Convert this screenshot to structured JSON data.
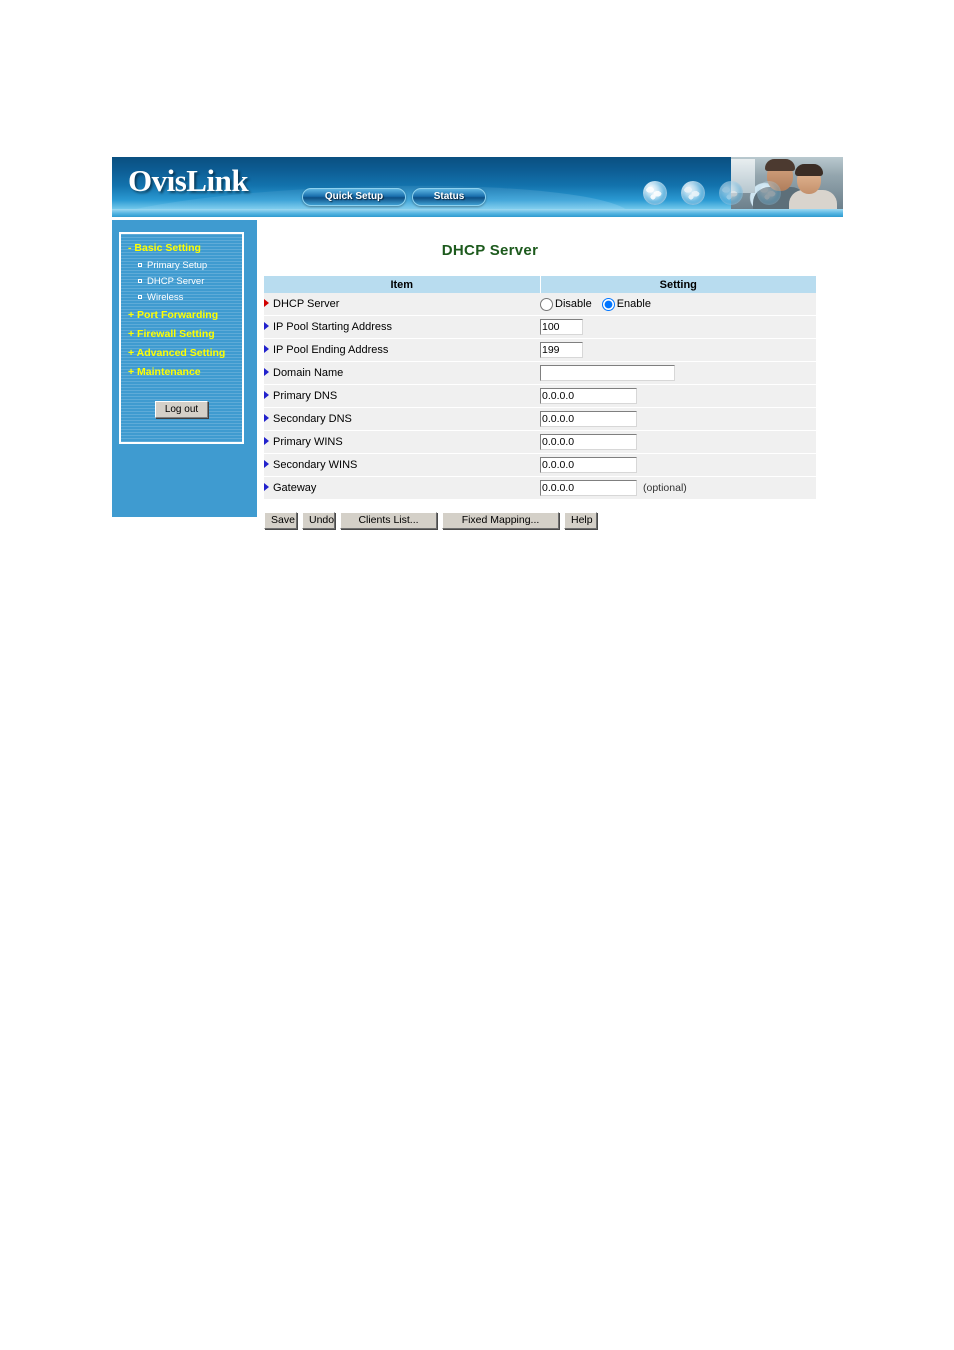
{
  "banner": {
    "logo_text": "OvisLink",
    "nav_pills": [
      {
        "label": "Quick Setup",
        "name": "quick-setup"
      },
      {
        "label": "Status",
        "name": "status"
      }
    ],
    "globe_icons": [
      "globe-icon-1",
      "globe-icon-2",
      "globe-icon-3",
      "globe-icon-4"
    ],
    "photo_alt": "family-at-computer-photo"
  },
  "sidebar": {
    "groups": [
      {
        "prefix": "-",
        "label": "Basic Setting",
        "expanded": true,
        "children": [
          {
            "label": "Primary Setup"
          },
          {
            "label": "DHCP Server"
          },
          {
            "label": "Wireless"
          }
        ]
      },
      {
        "prefix": "+",
        "label": "Port Forwarding",
        "expanded": false,
        "children": []
      },
      {
        "prefix": "+",
        "label": "Firewall Setting",
        "expanded": false,
        "children": []
      },
      {
        "prefix": "+",
        "label": "Advanced Setting",
        "expanded": false,
        "children": []
      },
      {
        "prefix": "+",
        "label": "Maintenance",
        "expanded": false,
        "children": []
      }
    ],
    "logout_label": "Log out"
  },
  "main": {
    "title": "DHCP Server",
    "table": {
      "headers": [
        "Item",
        "Setting"
      ],
      "rows": [
        {
          "item": "DHCP Server",
          "marker": "red",
          "control": "radio",
          "options": [
            {
              "label": "Disable",
              "checked": false
            },
            {
              "label": "Enable",
              "checked": true
            }
          ]
        },
        {
          "item": "IP Pool Starting Address",
          "marker": "blue",
          "control": "text",
          "value": "100",
          "size": "small"
        },
        {
          "item": "IP Pool Ending Address",
          "marker": "blue",
          "control": "text",
          "value": "199",
          "size": "small"
        },
        {
          "item": "Domain Name",
          "marker": "blue",
          "control": "text",
          "value": "",
          "size": "wide"
        },
        {
          "item": "Primary DNS",
          "marker": "blue",
          "control": "text",
          "value": "0.0.0.0",
          "size": "mid"
        },
        {
          "item": "Secondary DNS",
          "marker": "blue",
          "control": "text",
          "value": "0.0.0.0",
          "size": "mid"
        },
        {
          "item": "Primary WINS",
          "marker": "blue",
          "control": "text",
          "value": "0.0.0.0",
          "size": "mid"
        },
        {
          "item": "Secondary WINS",
          "marker": "blue",
          "control": "text",
          "value": "0.0.0.0",
          "size": "mid"
        },
        {
          "item": "Gateway",
          "marker": "blue",
          "control": "text",
          "value": "0.0.0.0",
          "size": "mid",
          "note": "(optional)"
        }
      ]
    },
    "buttons": [
      {
        "label": "Save",
        "name": "save-button"
      },
      {
        "label": "Undo",
        "name": "undo-button"
      },
      {
        "label": "Clients List...",
        "name": "clients-list-button"
      },
      {
        "label": "Fixed Mapping...",
        "name": "fixed-mapping-button"
      },
      {
        "label": "Help",
        "name": "help-button"
      }
    ]
  },
  "colors": {
    "banner_dark_blue": "#0a4f80",
    "sidebar_blue": "#3f9bd0",
    "menu_highlight_yellow": "#ffff00",
    "table_header_blue": "#b8dcef",
    "row_gray": "#f0f0f0",
    "title_green": "#1d5a1d",
    "marker_red": "#d10000",
    "marker_blue": "#2222cc"
  }
}
